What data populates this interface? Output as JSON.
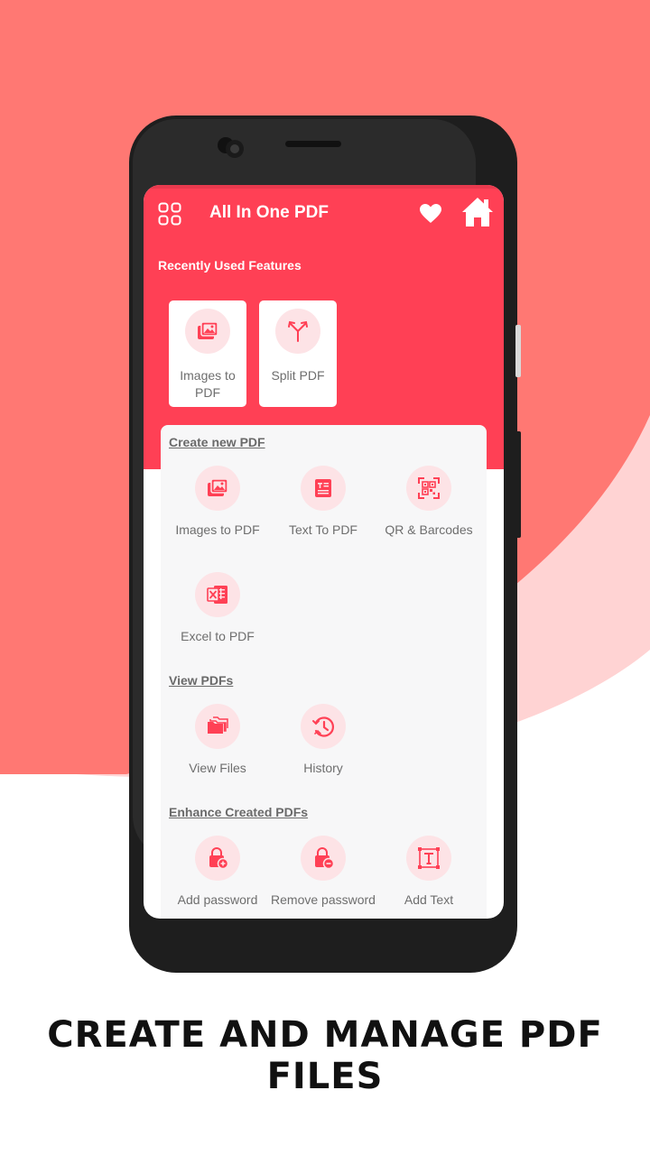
{
  "colors": {
    "accent": "#ff4055",
    "bg_coral": "#ff7873",
    "bg_pink": "#ffd3d3",
    "icon_circle": "#fde3e6",
    "icon_color": "#ff4055"
  },
  "app": {
    "title": "All In One PDF",
    "menu_icon": "grid-icon",
    "favorite_icon": "heart-icon",
    "home_icon": "home-icon"
  },
  "recent": {
    "label": "Recently Used Features",
    "items": [
      {
        "label": "Images to PDF",
        "icon": "images-icon"
      },
      {
        "label": "Split PDF",
        "icon": "split-icon"
      }
    ]
  },
  "sections": {
    "create": {
      "title": "Create new PDF",
      "items": [
        {
          "label": "Images to PDF",
          "icon": "images-icon"
        },
        {
          "label": "Text To PDF",
          "icon": "text-document-icon"
        },
        {
          "label": "QR & Barcodes",
          "icon": "qr-scan-icon"
        },
        {
          "label": "Excel to PDF",
          "icon": "excel-icon"
        }
      ]
    },
    "view": {
      "title": "View PDFs",
      "items": [
        {
          "label": "View Files",
          "icon": "folder-icon"
        },
        {
          "label": "History",
          "icon": "history-icon"
        }
      ]
    },
    "enhance": {
      "title": "Enhance Created PDFs",
      "items": [
        {
          "label": "Add password",
          "icon": "lock-add-icon"
        },
        {
          "label": "Remove password",
          "icon": "lock-remove-icon"
        },
        {
          "label": "Add Text",
          "icon": "add-text-icon"
        }
      ]
    }
  },
  "tagline": "CREATE  AND MANAGE PDF FILES"
}
